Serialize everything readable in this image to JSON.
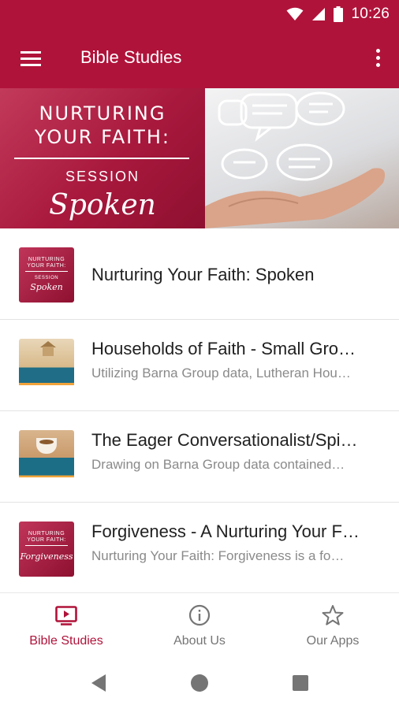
{
  "status_bar": {
    "time": "10:26",
    "icons": [
      "wifi-icon",
      "cellular-signal-icon",
      "battery-icon"
    ]
  },
  "app_bar": {
    "title": "Bible Studies",
    "menu_icon": "hamburger-menu-icon",
    "overflow_icon": "more-vert-icon"
  },
  "hero": {
    "line1": "NURTURING",
    "line2": "YOUR FAITH:",
    "session_label": "SESSION",
    "session_title": "Spoken",
    "art_icons": [
      "speech-bubble-icon",
      "open-hand-icon"
    ]
  },
  "studies": [
    {
      "title": "Nurturing Your Faith: Spoken",
      "subtitle": "",
      "thumb_icon": "nurturing-spoken-cover-icon"
    },
    {
      "title": "Households of Faith - Small Gro…",
      "subtitle": "Utilizing Barna Group data, Lutheran Hou…",
      "thumb_icon": "households-of-faith-cover-icon"
    },
    {
      "title": "The Eager Conversationalist/Spi…",
      "subtitle": "Drawing on Barna Group data contained…",
      "thumb_icon": "eager-conversationalist-cover-icon"
    },
    {
      "title": "Forgiveness - A Nurturing Your F…",
      "subtitle": "Nurturing Your Faith: Forgiveness is a fo…",
      "thumb_icon": "forgiveness-cover-icon"
    }
  ],
  "thumbs": {
    "red_line1": "NURTURING",
    "red_line2": "YOUR FAITH:",
    "red_session": "SESSION",
    "spoken": "Spoken",
    "forgiveness": "Forgiveness"
  },
  "bottom_nav": {
    "items": [
      {
        "label": "Bible Studies",
        "icon": "video-library-icon",
        "active": true
      },
      {
        "label": "About Us",
        "icon": "info-icon",
        "active": false
      },
      {
        "label": "Our Apps",
        "icon": "star-icon",
        "active": false
      }
    ]
  },
  "system_nav": [
    "back-icon",
    "home-icon",
    "recents-icon"
  ],
  "colors": {
    "primary": "#b0133a",
    "text_primary": "#212121",
    "text_secondary": "#8a8a8a",
    "inactive_nav": "#757575"
  }
}
